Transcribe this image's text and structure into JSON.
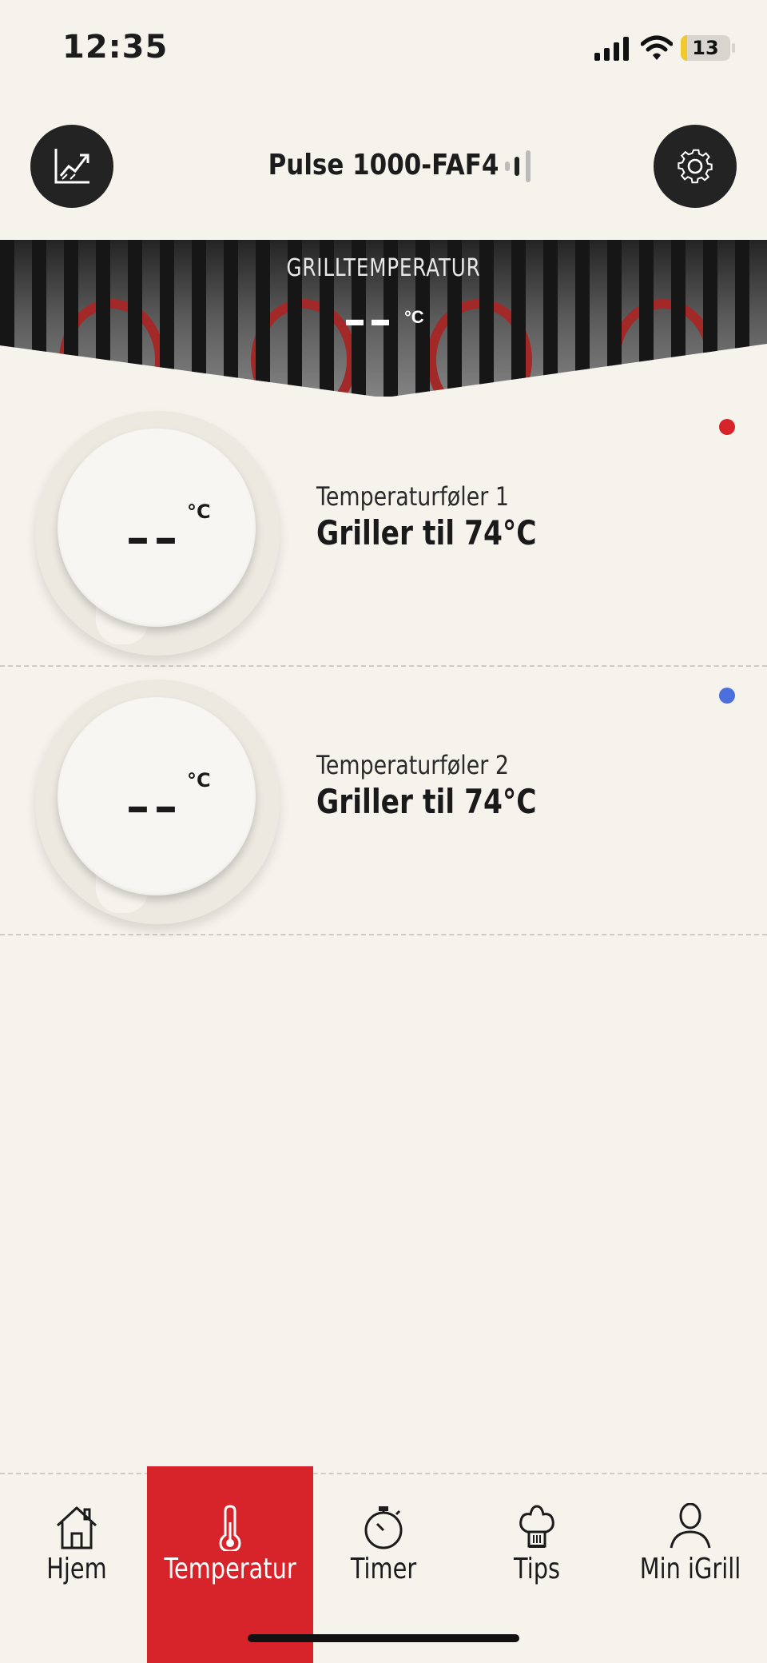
{
  "status_bar": {
    "time": "12:35",
    "battery": "13"
  },
  "header": {
    "title": "Pulse 1000-FAF4",
    "left_icon": "chart-trend-icon",
    "right_icon": "gear-icon"
  },
  "grill": {
    "label": "GRILLTEMPERATUR",
    "value": "––",
    "unit": "°C"
  },
  "probes": [
    {
      "name": "Temperaturføler 1",
      "status": "Griller til 74°C",
      "value": "––",
      "unit": "°C",
      "color": "#d7232a"
    },
    {
      "name": "Temperaturføler 2",
      "status": "Griller til 74°C",
      "value": "––",
      "unit": "°C",
      "color": "#4b6fdc"
    }
  ],
  "tabs": [
    {
      "label": "Hjem",
      "icon": "home-icon",
      "active": false
    },
    {
      "label": "Temperatur",
      "icon": "thermometer-icon",
      "active": true
    },
    {
      "label": "Timer",
      "icon": "stopwatch-icon",
      "active": false
    },
    {
      "label": "Tips",
      "icon": "chef-hat-icon",
      "active": false
    },
    {
      "label": "Min iGrill",
      "icon": "user-icon",
      "active": false
    }
  ],
  "colors": {
    "accent": "#d7232a",
    "background": "#f6f3ec",
    "dark": "#232323"
  }
}
